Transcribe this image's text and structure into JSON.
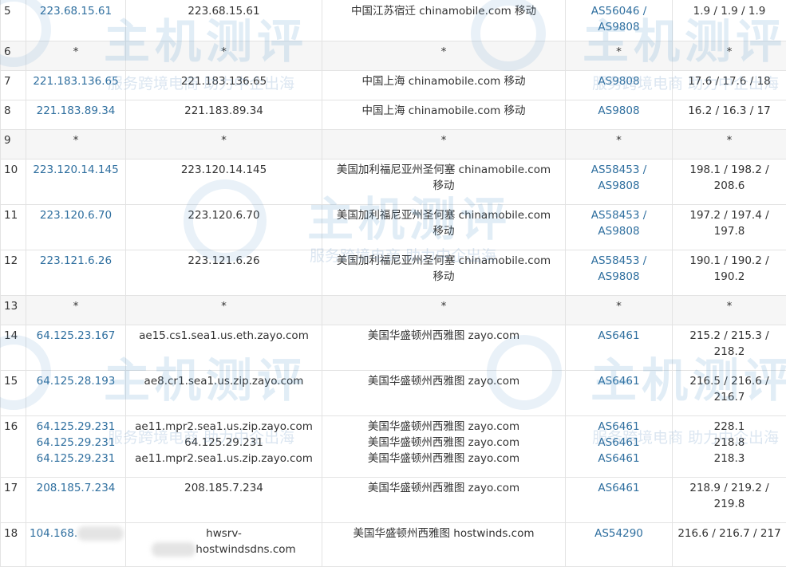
{
  "watermark": {
    "brand": "主机测评",
    "slogan": "服务跨境电商 助力中企出海"
  },
  "rows": [
    {
      "hop": "5",
      "ip": [
        "223.68.15.61"
      ],
      "host": [
        "223.68.15.61"
      ],
      "loc": [
        "中国江苏宿迁 chinamobile.com 移动"
      ],
      "asn": [
        "AS56046 /",
        "AS9808"
      ],
      "rtt": [
        "1.9 / 1.9 / 1.9"
      ]
    },
    {
      "hop": "6",
      "ip": [
        "*"
      ],
      "host": [
        "*"
      ],
      "loc": [
        "*"
      ],
      "asn": [
        "*"
      ],
      "rtt": [
        "*"
      ]
    },
    {
      "hop": "7",
      "ip": [
        "221.183.136.65"
      ],
      "host": [
        "221.183.136.65"
      ],
      "loc": [
        "中国上海 chinamobile.com 移动"
      ],
      "asn": [
        "AS9808"
      ],
      "rtt": [
        "17.6 / 17.6 / 18"
      ]
    },
    {
      "hop": "8",
      "ip": [
        "221.183.89.34"
      ],
      "host": [
        "221.183.89.34"
      ],
      "loc": [
        "中国上海 chinamobile.com 移动"
      ],
      "asn": [
        "AS9808"
      ],
      "rtt": [
        "16.2 / 16.3 / 17"
      ]
    },
    {
      "hop": "9",
      "ip": [
        "*"
      ],
      "host": [
        "*"
      ],
      "loc": [
        "*"
      ],
      "asn": [
        "*"
      ],
      "rtt": [
        "*"
      ]
    },
    {
      "hop": "10",
      "ip": [
        "223.120.14.145"
      ],
      "host": [
        "223.120.14.145"
      ],
      "loc": [
        "美国加利福尼亚州圣何塞 chinamobile.com",
        "移动"
      ],
      "asn": [
        "AS58453 /",
        "AS9808"
      ],
      "rtt": [
        "198.1 / 198.2 /",
        "208.6"
      ]
    },
    {
      "hop": "11",
      "ip": [
        "223.120.6.70"
      ],
      "host": [
        "223.120.6.70"
      ],
      "loc": [
        "美国加利福尼亚州圣何塞 chinamobile.com",
        "移动"
      ],
      "asn": [
        "AS58453 /",
        "AS9808"
      ],
      "rtt": [
        "197.2 / 197.4 /",
        "197.8"
      ]
    },
    {
      "hop": "12",
      "ip": [
        "223.121.6.26"
      ],
      "host": [
        "223.121.6.26"
      ],
      "loc": [
        "美国加利福尼亚州圣何塞 chinamobile.com",
        "移动"
      ],
      "asn": [
        "AS58453 /",
        "AS9808"
      ],
      "rtt": [
        "190.1 / 190.2 /",
        "190.2"
      ]
    },
    {
      "hop": "13",
      "ip": [
        "*"
      ],
      "host": [
        "*"
      ],
      "loc": [
        "*"
      ],
      "asn": [
        "*"
      ],
      "rtt": [
        "*"
      ]
    },
    {
      "hop": "14",
      "ip": [
        "64.125.23.167"
      ],
      "host": [
        "ae15.cs1.sea1.us.eth.zayo.com"
      ],
      "loc": [
        "美国华盛顿州西雅图 zayo.com"
      ],
      "asn": [
        "AS6461"
      ],
      "rtt": [
        "215.2 / 215.3 /",
        "218.2"
      ]
    },
    {
      "hop": "15",
      "ip": [
        "64.125.28.193"
      ],
      "host": [
        "ae8.cr1.sea1.us.zip.zayo.com"
      ],
      "loc": [
        "美国华盛顿州西雅图 zayo.com"
      ],
      "asn": [
        "AS6461"
      ],
      "rtt": [
        "216.5 / 216.6 /",
        "216.7"
      ]
    },
    {
      "hop": "16",
      "ip": [
        "64.125.29.231",
        "64.125.29.231",
        "64.125.29.231"
      ],
      "host": [
        "ae11.mpr2.sea1.us.zip.zayo.com",
        "64.125.29.231",
        "ae11.mpr2.sea1.us.zip.zayo.com"
      ],
      "loc": [
        "美国华盛顿州西雅图 zayo.com",
        "美国华盛顿州西雅图 zayo.com",
        "美国华盛顿州西雅图 zayo.com"
      ],
      "asn": [
        "AS6461",
        "AS6461",
        "AS6461"
      ],
      "rtt": [
        "228.1",
        "218.8",
        "218.3"
      ]
    },
    {
      "hop": "17",
      "ip": [
        "208.185.7.234"
      ],
      "host": [
        "208.185.7.234"
      ],
      "loc": [
        "美国华盛顿州西雅图 zayo.com"
      ],
      "asn": [
        "AS6461"
      ],
      "rtt": [
        "218.9 / 219.2 /",
        "219.8"
      ]
    },
    {
      "hop": "18",
      "ip": [
        "104.168."
      ],
      "host": [
        "hwsrv-",
        "hostwindsdns.com"
      ],
      "loc": [
        "美国华盛顿州西雅图 hostwinds.com"
      ],
      "asn": [
        "AS54290"
      ],
      "rtt": [
        "216.6 / 216.7 / 217"
      ]
    }
  ]
}
